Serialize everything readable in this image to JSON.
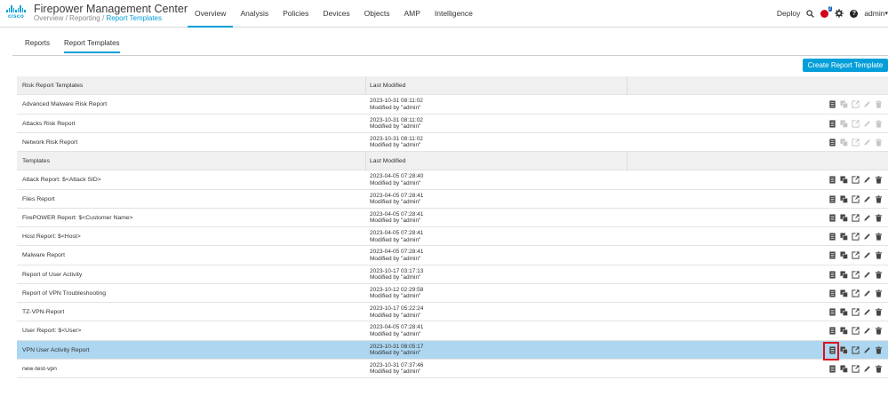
{
  "brand": {
    "logo_text": "cisco",
    "app_title": "Firepower Management Center"
  },
  "breadcrumb": {
    "part1": "Overview",
    "sep1": "/",
    "part2": "Reporting",
    "sep2": "/",
    "part3": "Report Templates"
  },
  "nav": [
    "Overview",
    "Analysis",
    "Policies",
    "Devices",
    "Objects",
    "AMP",
    "Intelligence"
  ],
  "nav_active": "Overview",
  "utility": {
    "deploy": "Deploy",
    "notification_count": "2",
    "user": "admin"
  },
  "subtabs": {
    "reports": "Reports",
    "report_templates": "Report Templates"
  },
  "create_button": "Create Report Template",
  "risk_section": {
    "header": "Risk Report Templates",
    "last_modified_header": "Last Modified"
  },
  "risk_rows": [
    {
      "name": "Advanced Malware Risk Report",
      "date": "2023-10-31 08:11:02",
      "by": "Modified by \"admin\""
    },
    {
      "name": "Attacks Risk Report",
      "date": "2023-10-31 08:11:02",
      "by": "Modified by \"admin\""
    },
    {
      "name": "Network Risk Report",
      "date": "2023-10-31 08:11:02",
      "by": "Modified by \"admin\""
    }
  ],
  "templates_section": {
    "header": "Templates",
    "last_modified_header": "Last Modified"
  },
  "template_rows": [
    {
      "name": "Attack Report: $<Attack SID>",
      "date": "2023-04-05 07:28:40",
      "by": "Modified by \"admin\""
    },
    {
      "name": "Files Report",
      "date": "2023-04-05 07:28:41",
      "by": "Modified by \"admin\""
    },
    {
      "name": "FirePOWER Report: $<Customer Name>",
      "date": "2023-04-05 07:28:41",
      "by": "Modified by \"admin\""
    },
    {
      "name": "Host Report: $<Host>",
      "date": "2023-04-05 07:28:41",
      "by": "Modified by \"admin\""
    },
    {
      "name": "Malware Report",
      "date": "2023-04-05 07:28:41",
      "by": "Modified by \"admin\""
    },
    {
      "name": "Report of User Activity",
      "date": "2023-10-17 03:17:13",
      "by": "Modified by \"admin\""
    },
    {
      "name": "Report of VPN Troubleshooting",
      "date": "2023-10-12 02:29:58",
      "by": "Modified by \"admin\""
    },
    {
      "name": "TZ-VPN-Report",
      "date": "2023-10-17 05:22:24",
      "by": "Modified by \"admin\""
    },
    {
      "name": "User Report: $<User>",
      "date": "2023-04-05 07:28:41",
      "by": "Modified by \"admin\""
    },
    {
      "name": "VPN User Activity Report",
      "date": "2023-10-31 08:05:17",
      "by": "Modified by \"admin\""
    },
    {
      "name": "new-test-vpn",
      "date": "2023-10-31 07:37:46",
      "by": "Modified by \"admin\""
    }
  ],
  "selected_template_index": 9,
  "colors": {
    "accent": "#049fd9",
    "selected_row": "#add6f0",
    "highlight_box": "#e0101f",
    "header_bg": "#f0f0f0"
  }
}
